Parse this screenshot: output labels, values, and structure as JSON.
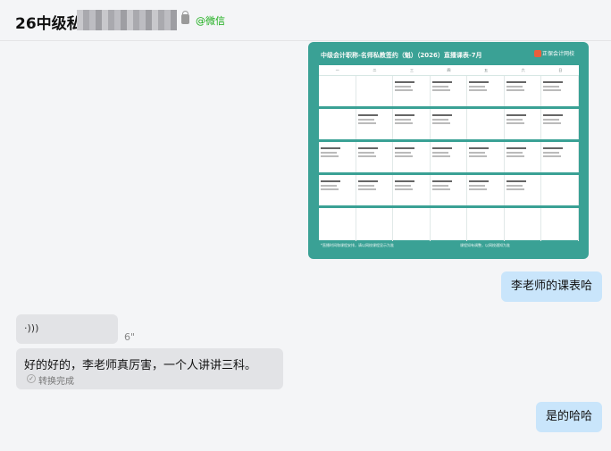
{
  "header": {
    "title": "26中级私",
    "tag": "@微信"
  },
  "schedule_image": {
    "title": "中级会计职称-名师私教签约（魁）（2026）直播课表-7月",
    "logo_text": "正保会计网校",
    "footer_left": "*直播时间和课程安排，请以网校课程显示为准",
    "footer_right": "课程如有调整，以网校通知为准"
  },
  "messages": [
    {
      "side": "right",
      "text": "李老师的课表哈"
    },
    {
      "side": "left",
      "type": "voice",
      "icon": "voice-wave-icon",
      "duration": "6\""
    },
    {
      "side": "left",
      "type": "transcript",
      "text": "好的好的，李老师真厉害，一个人讲讲三科。",
      "status": "转换完成"
    },
    {
      "side": "right",
      "text": "是的哈哈"
    }
  ]
}
